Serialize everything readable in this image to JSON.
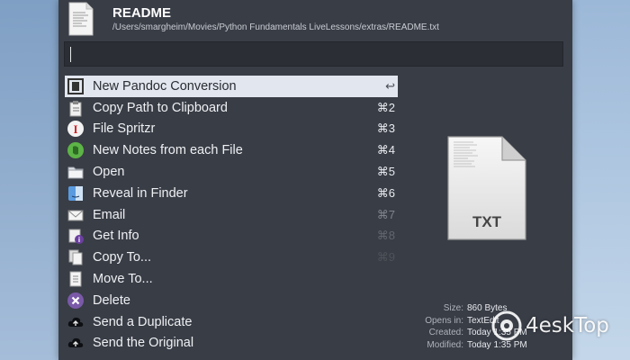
{
  "header": {
    "title": "README",
    "path": "/Users/smargheim/Movies/Python Fundamentals LiveLessons/extras/README.txt"
  },
  "search": {
    "value": ""
  },
  "actions": [
    {
      "label": "New Pandoc Conversion",
      "shortcut": "↩",
      "icon": "pandoc-icon",
      "selected": true
    },
    {
      "label": "Copy Path to Clipboard",
      "shortcut": "⌘2",
      "icon": "clipboard-icon"
    },
    {
      "label": "File Spritzr",
      "shortcut": "⌘3",
      "icon": "spritzr-icon"
    },
    {
      "label": "New Notes from each File",
      "shortcut": "⌘4",
      "icon": "evernote-icon"
    },
    {
      "label": "Open",
      "shortcut": "⌘5",
      "icon": "folder-icon"
    },
    {
      "label": "Reveal in Finder",
      "shortcut": "⌘6",
      "icon": "finder-icon"
    },
    {
      "label": "Email",
      "shortcut": "⌘7",
      "icon": "envelope-icon"
    },
    {
      "label": "Get Info",
      "shortcut": "⌘8",
      "icon": "info-icon"
    },
    {
      "label": "Copy To...",
      "shortcut": "⌘9",
      "icon": "copy-icon"
    },
    {
      "label": "Move To...",
      "shortcut": "",
      "icon": "move-icon"
    },
    {
      "label": "Delete",
      "shortcut": "",
      "icon": "delete-icon"
    },
    {
      "label": "Send a Duplicate",
      "shortcut": "",
      "icon": "cloud-upload-icon"
    },
    {
      "label": "Send the Original",
      "shortcut": "",
      "icon": "cloud-upload-icon"
    }
  ],
  "preview": {
    "file_type": "TXT"
  },
  "file_info": [
    {
      "key": "Size:",
      "value": "860 Bytes"
    },
    {
      "key": "Opens in:",
      "value": "TextEdit"
    },
    {
      "key": "Created:",
      "value": "Today 1:35 PM"
    },
    {
      "key": "Modified:",
      "value": "Today 1:35 PM"
    }
  ],
  "watermark": {
    "text": "4eskTop"
  },
  "colors": {
    "panel": "#393d46",
    "selection": "#e2e6ee",
    "desktop": "#a9c2df"
  }
}
